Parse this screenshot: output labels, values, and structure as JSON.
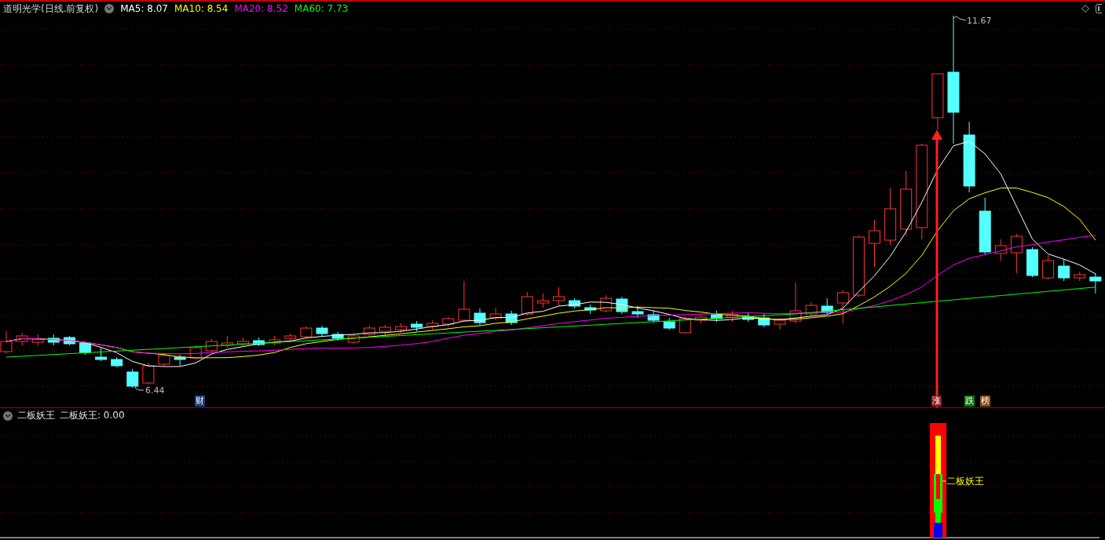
{
  "header": {
    "title": "道明光学(日线.前复权)",
    "ma": [
      {
        "label": "MA5: 8.07",
        "color": "#ffffff"
      },
      {
        "label": "MA10: 8.54",
        "color": "#ffff00"
      },
      {
        "label": "MA20: 8.52",
        "color": "#ff00ff"
      },
      {
        "label": "MA60: 7.73",
        "color": "#00ff00"
      }
    ]
  },
  "price_chart": {
    "high_label": "11.67",
    "low_label": "6.44",
    "event_markers": [
      {
        "text": "财",
        "color": "#1f3f7f"
      },
      {
        "text": "涨",
        "color": "#8b1a1a"
      },
      {
        "text": "跌",
        "color": "#0a7a0a"
      },
      {
        "text": "榜",
        "color": "#8b4a12"
      }
    ]
  },
  "indicator": {
    "name": "二板妖王",
    "reading": "二板妖王: 0.00",
    "signal_label": "二板妖王"
  }
}
